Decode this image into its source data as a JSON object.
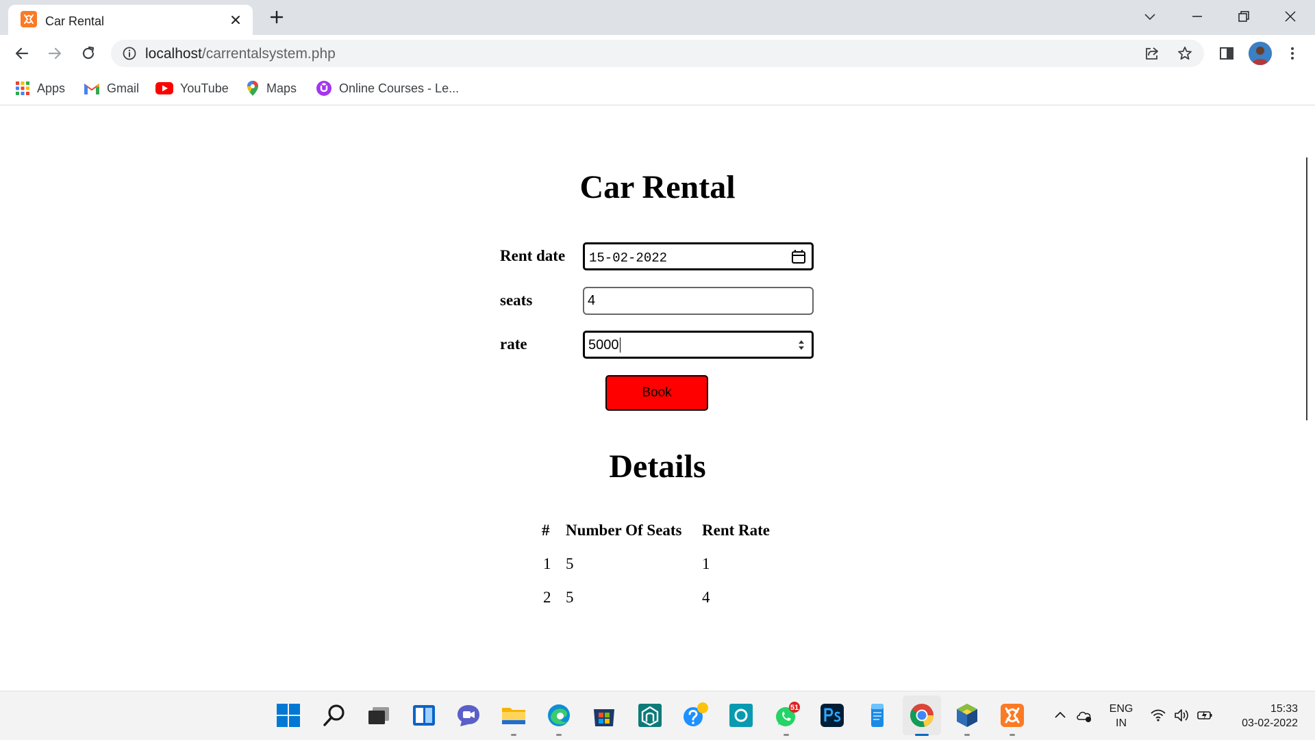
{
  "browser": {
    "tab_title": "Car Rental",
    "url_host": "localhost",
    "url_path": "/carrentalsystem.php",
    "bookmarks": [
      {
        "label": "Apps",
        "icon": "apps-grid-icon"
      },
      {
        "label": "Gmail",
        "icon": "gmail-icon"
      },
      {
        "label": "YouTube",
        "icon": "youtube-icon"
      },
      {
        "label": "Maps",
        "icon": "maps-icon"
      },
      {
        "label": "Online Courses - Le...",
        "icon": "udemy-icon"
      }
    ]
  },
  "page": {
    "title": "Car Rental",
    "form": {
      "rent_date_label": "Rent date",
      "rent_date_value": "15-02-2022",
      "seats_label": "seats",
      "seats_value": "4",
      "rate_label": "rate",
      "rate_value": "5000",
      "book_label": "Book"
    },
    "details": {
      "title": "Details",
      "headers": [
        "#",
        "Number Of Seats",
        "Rent Rate"
      ],
      "rows": [
        [
          "1",
          "5",
          "1"
        ],
        [
          "2",
          "5",
          "4"
        ]
      ]
    }
  },
  "taskbar": {
    "whatsapp_badge": "51",
    "lang_line1": "ENG",
    "lang_line2": "IN",
    "time": "15:33",
    "date": "03-02-2022"
  },
  "colors": {
    "book_button": "#ff0000",
    "tab_strip": "#dee1e6",
    "taskbar": "#f3f3f3"
  }
}
